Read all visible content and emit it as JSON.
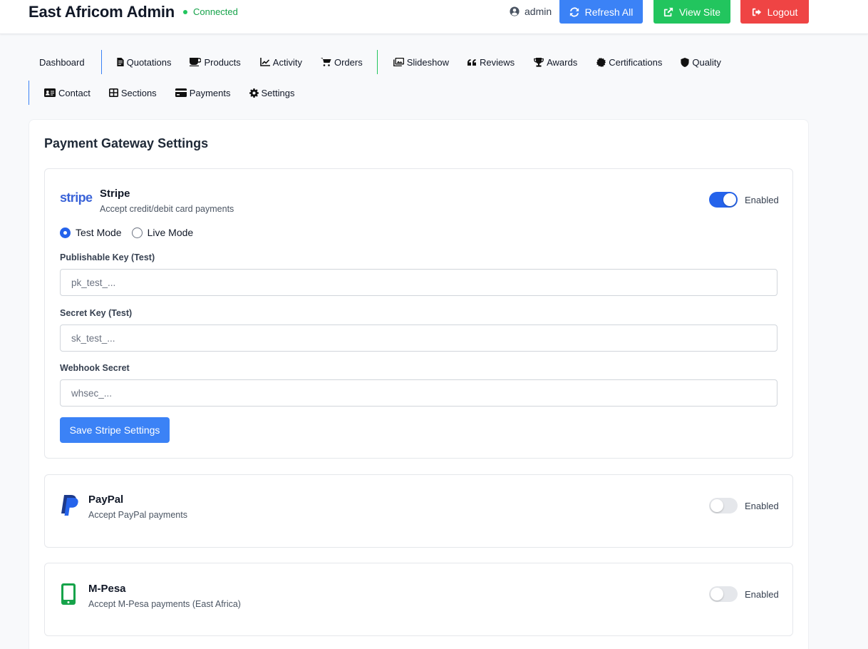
{
  "header": {
    "brand": "East Africom Admin",
    "status": "Connected",
    "user": "admin",
    "refresh_label": "Refresh All",
    "view_site_label": "View Site",
    "logout_label": "Logout"
  },
  "nav": {
    "row1": [
      "Dashboard",
      "Quotations",
      "Products",
      "Activity",
      "Orders",
      "Slideshow",
      "Reviews",
      "Awards",
      "Certifications",
      "Quality"
    ],
    "row2": [
      "Contact",
      "Sections",
      "Payments",
      "Settings"
    ]
  },
  "page": {
    "title": "Payment Gateway Settings"
  },
  "stripe": {
    "logo": "stripe",
    "name": "Stripe",
    "description": "Accept credit/debit card payments",
    "enabled_label": "Enabled",
    "enabled": true,
    "modes": [
      "Test Mode",
      "Live Mode"
    ],
    "selected_mode": "Test Mode",
    "publishable_label": "Publishable Key (Test)",
    "publishable_placeholder": "pk_test_...",
    "publishable_value": "",
    "secret_label": "Secret Key (Test)",
    "secret_placeholder": "sk_test_...",
    "secret_value": "",
    "webhook_label": "Webhook Secret",
    "webhook_placeholder": "whsec_...",
    "webhook_value": "",
    "save_label": "Save Stripe Settings"
  },
  "paypal": {
    "name": "PayPal",
    "description": "Accept PayPal payments",
    "enabled_label": "Enabled",
    "enabled": false
  },
  "mpesa": {
    "name": "M-Pesa",
    "description": "Accept M-Pesa payments (East Africa)",
    "enabled_label": "Enabled",
    "enabled": false
  },
  "colors": {
    "primary": "#3b82f6",
    "success": "#22c55e",
    "danger": "#ef4444",
    "toggle_on": "#2563eb",
    "stripe_brand": "#635bff",
    "paypal_brand": "#1e40af",
    "mpesa_brand": "#16a34a"
  }
}
